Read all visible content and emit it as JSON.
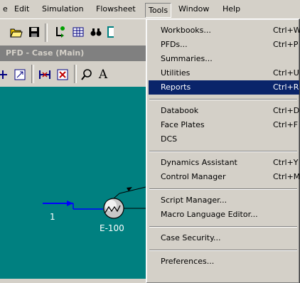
{
  "menubar": {
    "items": [
      {
        "label": "e"
      },
      {
        "label": "Edit"
      },
      {
        "label": "Simulation"
      },
      {
        "label": "Flowsheet"
      },
      {
        "label": "Tools"
      },
      {
        "label": "Window"
      },
      {
        "label": "Help"
      }
    ]
  },
  "window": {
    "title": "PFD - Case (Main)"
  },
  "toolbar2": {
    "text_tool_label": "A"
  },
  "flowsheet": {
    "stream_label": "1",
    "exchanger_label": "E-100",
    "colors": {
      "background": "#008080",
      "stream": "#0000ff"
    }
  },
  "tools_menu": {
    "highlight_color": "#0a246a",
    "items": [
      {
        "label": "Workbooks...",
        "shortcut": "Ctrl+W"
      },
      {
        "label": "PFDs...",
        "shortcut": "Ctrl+P"
      },
      {
        "label": "Summaries...",
        "shortcut": ""
      },
      {
        "label": "Utilities",
        "shortcut": "Ctrl+U"
      },
      {
        "label": "Reports",
        "shortcut": "Ctrl+R"
      },
      {
        "label": "Databook",
        "shortcut": "Ctrl+D"
      },
      {
        "label": "Face Plates",
        "shortcut": "Ctrl+F"
      },
      {
        "label": "DCS",
        "shortcut": ""
      },
      {
        "label": "Dynamics Assistant",
        "shortcut": "Ctrl+Y"
      },
      {
        "label": "Control Manager",
        "shortcut": "Ctrl+M"
      },
      {
        "label": "Script Manager...",
        "shortcut": ""
      },
      {
        "label": "Macro Language Editor...",
        "shortcut": ""
      },
      {
        "label": "Case Security...",
        "shortcut": ""
      },
      {
        "label": "Preferences...",
        "shortcut": ""
      }
    ]
  }
}
